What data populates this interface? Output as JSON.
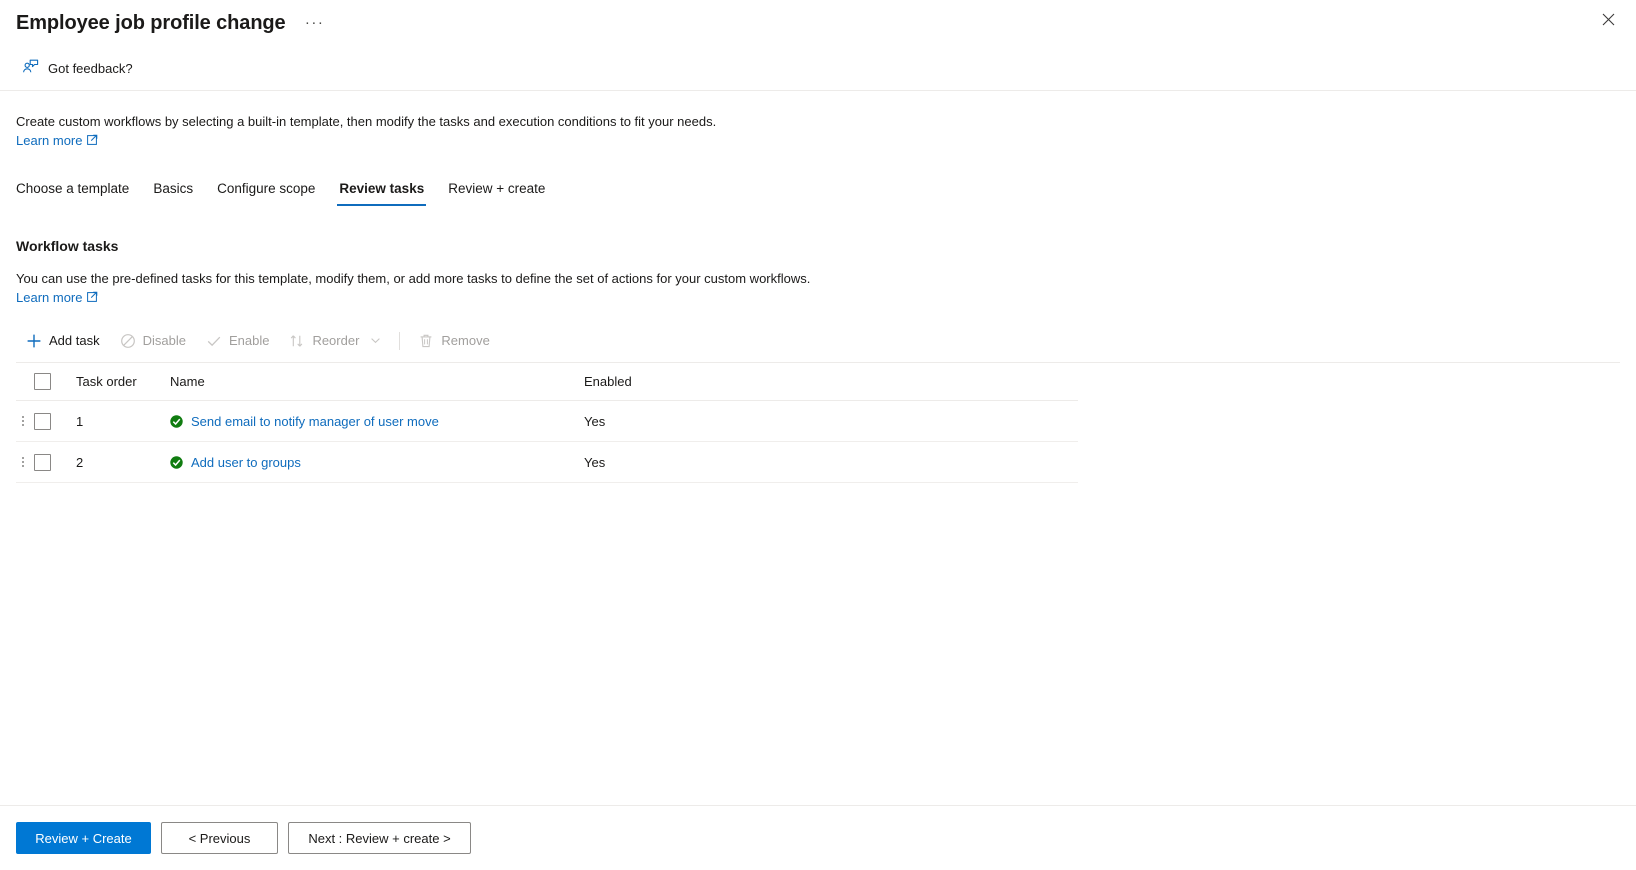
{
  "blade": {
    "title": "Employee job profile change",
    "ellipsis_label": "···",
    "close_label": "Close",
    "close_icon": "close-icon"
  },
  "feedback": {
    "label": "Got feedback?",
    "icon": "feedback-person-icon"
  },
  "intro": {
    "description": "Create custom workflows by selecting a built-in template, then modify the tasks and execution conditions to fit your needs.",
    "learn_more": "Learn more",
    "external_icon": "external-link-icon"
  },
  "tabs": [
    {
      "label": "Choose a template",
      "active": false
    },
    {
      "label": "Basics",
      "active": false
    },
    {
      "label": "Configure scope",
      "active": false
    },
    {
      "label": "Review tasks",
      "active": true
    },
    {
      "label": "Review + create",
      "active": false
    }
  ],
  "section": {
    "title": "Workflow tasks",
    "description": "You can use the pre-defined tasks for this template, modify them, or add more tasks to define the set of actions for your custom workflows.",
    "learn_more": "Learn more",
    "external_icon": "external-link-icon"
  },
  "commandbar": {
    "add_task": {
      "label": "Add task",
      "icon": "plus-icon",
      "disabled": false
    },
    "disable": {
      "label": "Disable",
      "icon": "block-circle-icon",
      "disabled": true
    },
    "enable": {
      "label": "Enable",
      "icon": "checkmark-icon",
      "disabled": true
    },
    "reorder": {
      "label": "Reorder",
      "icon": "sort-arrows-icon",
      "chevron": "chevron-down-icon",
      "disabled": true
    },
    "remove": {
      "label": "Remove",
      "icon": "trash-icon",
      "disabled": true
    }
  },
  "table": {
    "columns": {
      "task_order": "Task order",
      "name": "Name",
      "enabled": "Enabled"
    },
    "rows": [
      {
        "order": "1",
        "name": "Send email to notify manager of user move",
        "enabled": "Yes",
        "status_icon": "green-check-circle-icon"
      },
      {
        "order": "2",
        "name": "Add user to groups",
        "enabled": "Yes",
        "status_icon": "green-check-circle-icon"
      }
    ]
  },
  "footer": {
    "review_create": "Review + Create",
    "previous": "< Previous",
    "next": "Next : Review + create >"
  },
  "colors": {
    "accent": "#0078d4",
    "link": "#0f6cbd",
    "success": "#107c10",
    "disabled_text": "#a19f9d",
    "text": "#1b1a19",
    "divider": "#edebe9"
  }
}
